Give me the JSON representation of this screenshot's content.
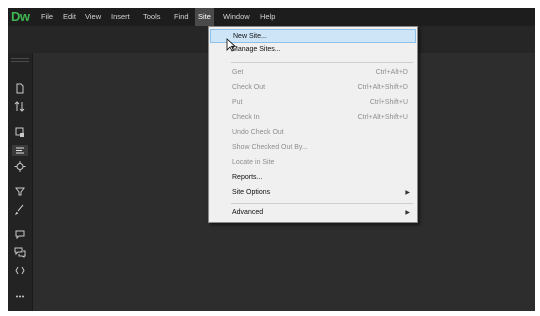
{
  "app": {
    "logo": "Dw"
  },
  "menubar": {
    "items": [
      "File",
      "Edit",
      "View",
      "Insert",
      "Tools",
      "Find",
      "Site",
      "Window",
      "Help"
    ]
  },
  "toolbar_icons": [
    "document-icon",
    "transfer-icon",
    "insert-panel-icon",
    "code-lines-icon",
    "target-icon",
    "filter-icon",
    "brush-icon",
    "comment-icon",
    "comments-icon",
    "tag-icon",
    "more-icon"
  ],
  "site_menu": {
    "items": [
      {
        "label": "New Site...",
        "enabled": true
      },
      {
        "label": "Manage Sites...",
        "enabled": true
      },
      {
        "label": "Get",
        "shortcut": "Ctrl+Alt+D",
        "enabled": false
      },
      {
        "label": "Check Out",
        "shortcut": "Ctrl+Alt+Shift+D",
        "enabled": false
      },
      {
        "label": "Put",
        "shortcut": "Ctrl+Shift+U",
        "enabled": false
      },
      {
        "label": "Check In",
        "shortcut": "Ctrl+Alt+Shift+U",
        "enabled": false
      },
      {
        "label": "Undo Check Out",
        "enabled": false
      },
      {
        "label": "Show Checked Out By...",
        "enabled": false
      },
      {
        "label": "Locate in Site",
        "enabled": false
      },
      {
        "label": "Reports...",
        "enabled": true
      },
      {
        "label": "Site Options",
        "enabled": true,
        "submenu": true
      },
      {
        "label": "Advanced",
        "enabled": true,
        "submenu": true
      }
    ]
  },
  "colors": {
    "accent": "#3fb64f",
    "menu_hover": "#cde5f7"
  }
}
